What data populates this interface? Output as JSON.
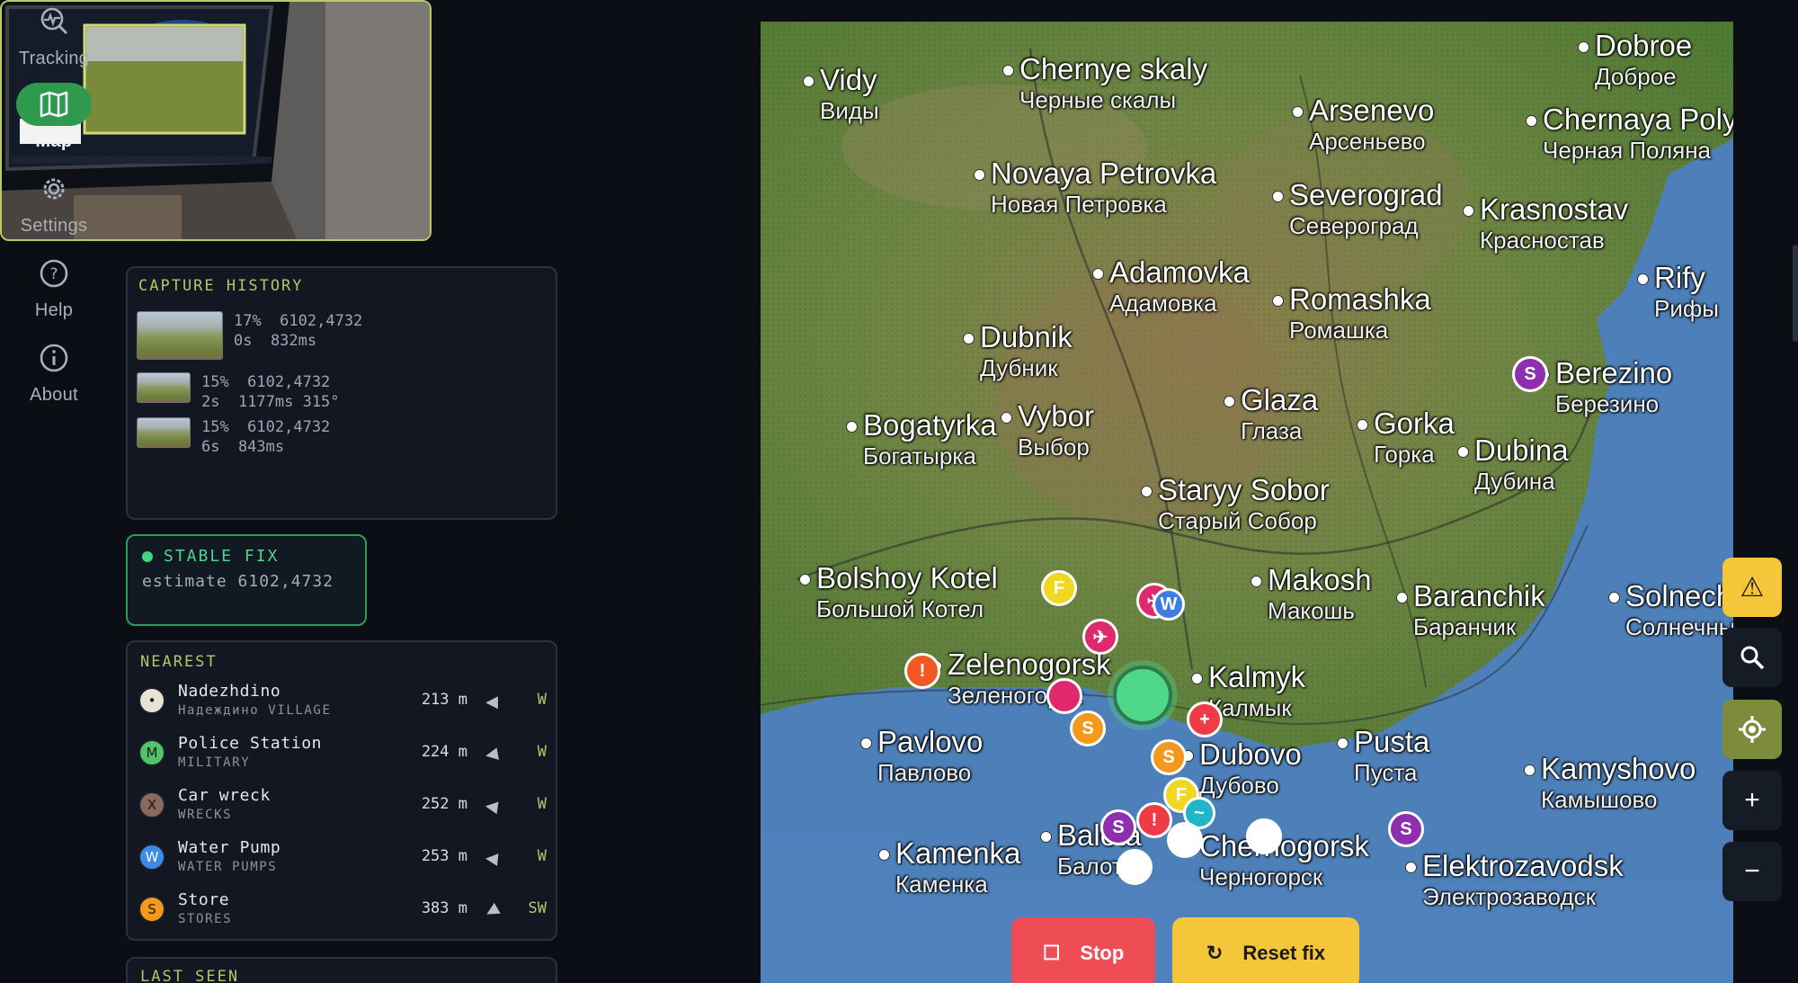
{
  "nav": {
    "tracking": "Tracking",
    "map": "Map",
    "settings": "Settings",
    "help": "Help",
    "about": "About"
  },
  "history": {
    "title": "CAPTURE HISTORY",
    "rows": [
      {
        "line1": "17%  6102,4732",
        "line2": "0s  832ms"
      },
      {
        "line1": "15%  6102,4732",
        "line2": "2s  1177ms 315°"
      },
      {
        "line1": "15%  6102,4732",
        "line2": "6s  843ms"
      }
    ]
  },
  "fix": {
    "title": "STABLE FIX",
    "estimate": "estimate 6102,4732",
    "color": "#47d47e"
  },
  "nearest": {
    "title": "NEAREST",
    "items": [
      {
        "badge": "•",
        "color": "#e8e2d2",
        "name": "Nadezhdino",
        "sub": "Надеждино VILLAGE",
        "dist": "213 m",
        "dir": "W"
      },
      {
        "badge": "M",
        "color": "#4fc46a",
        "name": "Police Station",
        "sub": "MILITARY",
        "dist": "224 m",
        "dir": "W"
      },
      {
        "badge": "X",
        "color": "#8a6a5c",
        "name": "Car wreck",
        "sub": "WRECKS",
        "dist": "252 m",
        "dir": "W"
      },
      {
        "badge": "W",
        "color": "#3d8be6",
        "name": "Water Pump",
        "sub": "WATER PUMPS",
        "dist": "253 m",
        "dir": "W"
      },
      {
        "badge": "S",
        "color": "#f39a1e",
        "name": "Store",
        "sub": "STORES",
        "dist": "383 m",
        "dir": "SW"
      }
    ]
  },
  "last_seen": {
    "title": "LAST SEEN"
  },
  "map": {
    "places": [
      {
        "en": "Vidy",
        "ru": "Виды"
      },
      {
        "en": "Chernye skaly",
        "ru": "Черные скалы"
      },
      {
        "en": "Arsenevo",
        "ru": "Арсеньево"
      },
      {
        "en": "Dobroe",
        "ru": "Доброе"
      },
      {
        "en": "Chernaya Polyana",
        "ru": "Черная Поляна"
      },
      {
        "en": "Novaya Petrovka",
        "ru": "Новая Петровка"
      },
      {
        "en": "Severograd",
        "ru": "Североград"
      },
      {
        "en": "Krasnostav",
        "ru": "Красностав"
      },
      {
        "en": "Adamovka",
        "ru": "Адамовка"
      },
      {
        "en": "Romashka",
        "ru": "Ромашка"
      },
      {
        "en": "Rify",
        "ru": "Рифы"
      },
      {
        "en": "Dubnik",
        "ru": "Дубник"
      },
      {
        "en": "Berezino",
        "ru": "Березино"
      },
      {
        "en": "Glaza",
        "ru": "Глаза"
      },
      {
        "en": "Bogatyrka",
        "ru": "Богатырка"
      },
      {
        "en": "Vybor",
        "ru": "Выбор"
      },
      {
        "en": "Gorka",
        "ru": "Горка"
      },
      {
        "en": "Dubina",
        "ru": "Дубина"
      },
      {
        "en": "Staryy Sobor",
        "ru": "Старый Собор"
      },
      {
        "en": "Bolshoy Kotel",
        "ru": "Большой Котел"
      },
      {
        "en": "Makosh",
        "ru": "Макошь"
      },
      {
        "en": "Baranchik",
        "ru": "Баранчик"
      },
      {
        "en": "Solnechniy",
        "ru": "Солнечный"
      },
      {
        "en": "Zelenogorsk",
        "ru": "Зеленогорск"
      },
      {
        "en": "Kalmyk",
        "ru": "Калмык"
      },
      {
        "en": "Pavlovo",
        "ru": "Павлово"
      },
      {
        "en": "Dubovo",
        "ru": "Дубово"
      },
      {
        "en": "Pusta",
        "ru": "Пуста"
      },
      {
        "en": "Kamyshovo",
        "ru": "Камышово"
      },
      {
        "en": "Balota",
        "ru": "Балота"
      },
      {
        "en": "Kamenka",
        "ru": "Каменка"
      },
      {
        "en": "Chernogorsk",
        "ru": "Черногорск"
      },
      {
        "en": "Elektrozavodsk",
        "ru": "Электрозаводск"
      }
    ]
  },
  "buttons": {
    "stop": "Stop",
    "reset": "Reset fix"
  },
  "colors": {
    "accent_green": "#2e9a4e",
    "title_olive": "#b4c56a",
    "stop_red": "#ef4d55",
    "reset_yellow": "#f5c53a"
  }
}
